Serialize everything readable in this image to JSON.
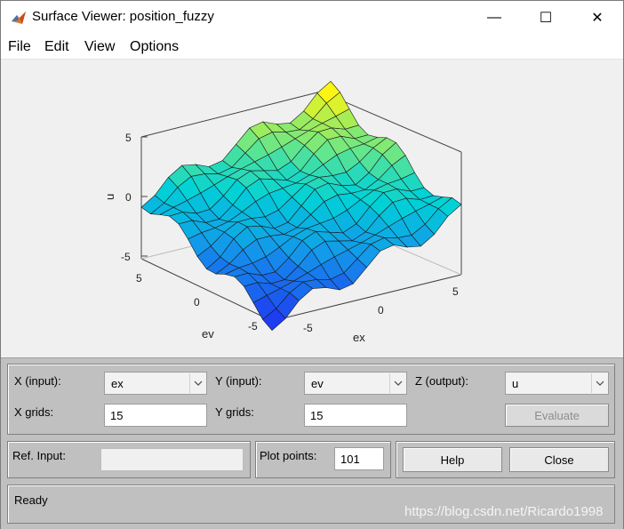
{
  "window": {
    "title": "Surface Viewer: position_fuzzy",
    "minimize_glyph": "—",
    "maximize_glyph": "☐",
    "close_glyph": "✕",
    "app_icon": "matlab-logo-icon"
  },
  "menu": {
    "items": [
      "File",
      "Edit",
      "View",
      "Options"
    ]
  },
  "plot": {
    "zlabel": "u",
    "xlabel": "ex",
    "ylabel": "ev",
    "z_ticks": [
      "5",
      "0",
      "-5"
    ],
    "x_ticks": [
      "-5",
      "0",
      "5"
    ],
    "y_ticks": [
      "5",
      "0",
      "-5"
    ],
    "colormap": "parula",
    "grid": 15
  },
  "controls": {
    "x_input_label": "X (input):",
    "x_input_value": "ex",
    "y_input_label": "Y (input):",
    "y_input_value": "ev",
    "z_output_label": "Z (output):",
    "z_output_value": "u",
    "x_grids_label": "X grids:",
    "x_grids_value": "15",
    "y_grids_label": "Y grids:",
    "y_grids_value": "15",
    "evaluate_label": "Evaluate",
    "ref_input_label": "Ref. Input:",
    "ref_input_value": "",
    "plot_points_label": "Plot points:",
    "plot_points_value": "101",
    "help_label": "Help",
    "close_label": "Close",
    "status_text": "Ready"
  },
  "watermark": "https://blog.csdn.net/Ricardo1998"
}
